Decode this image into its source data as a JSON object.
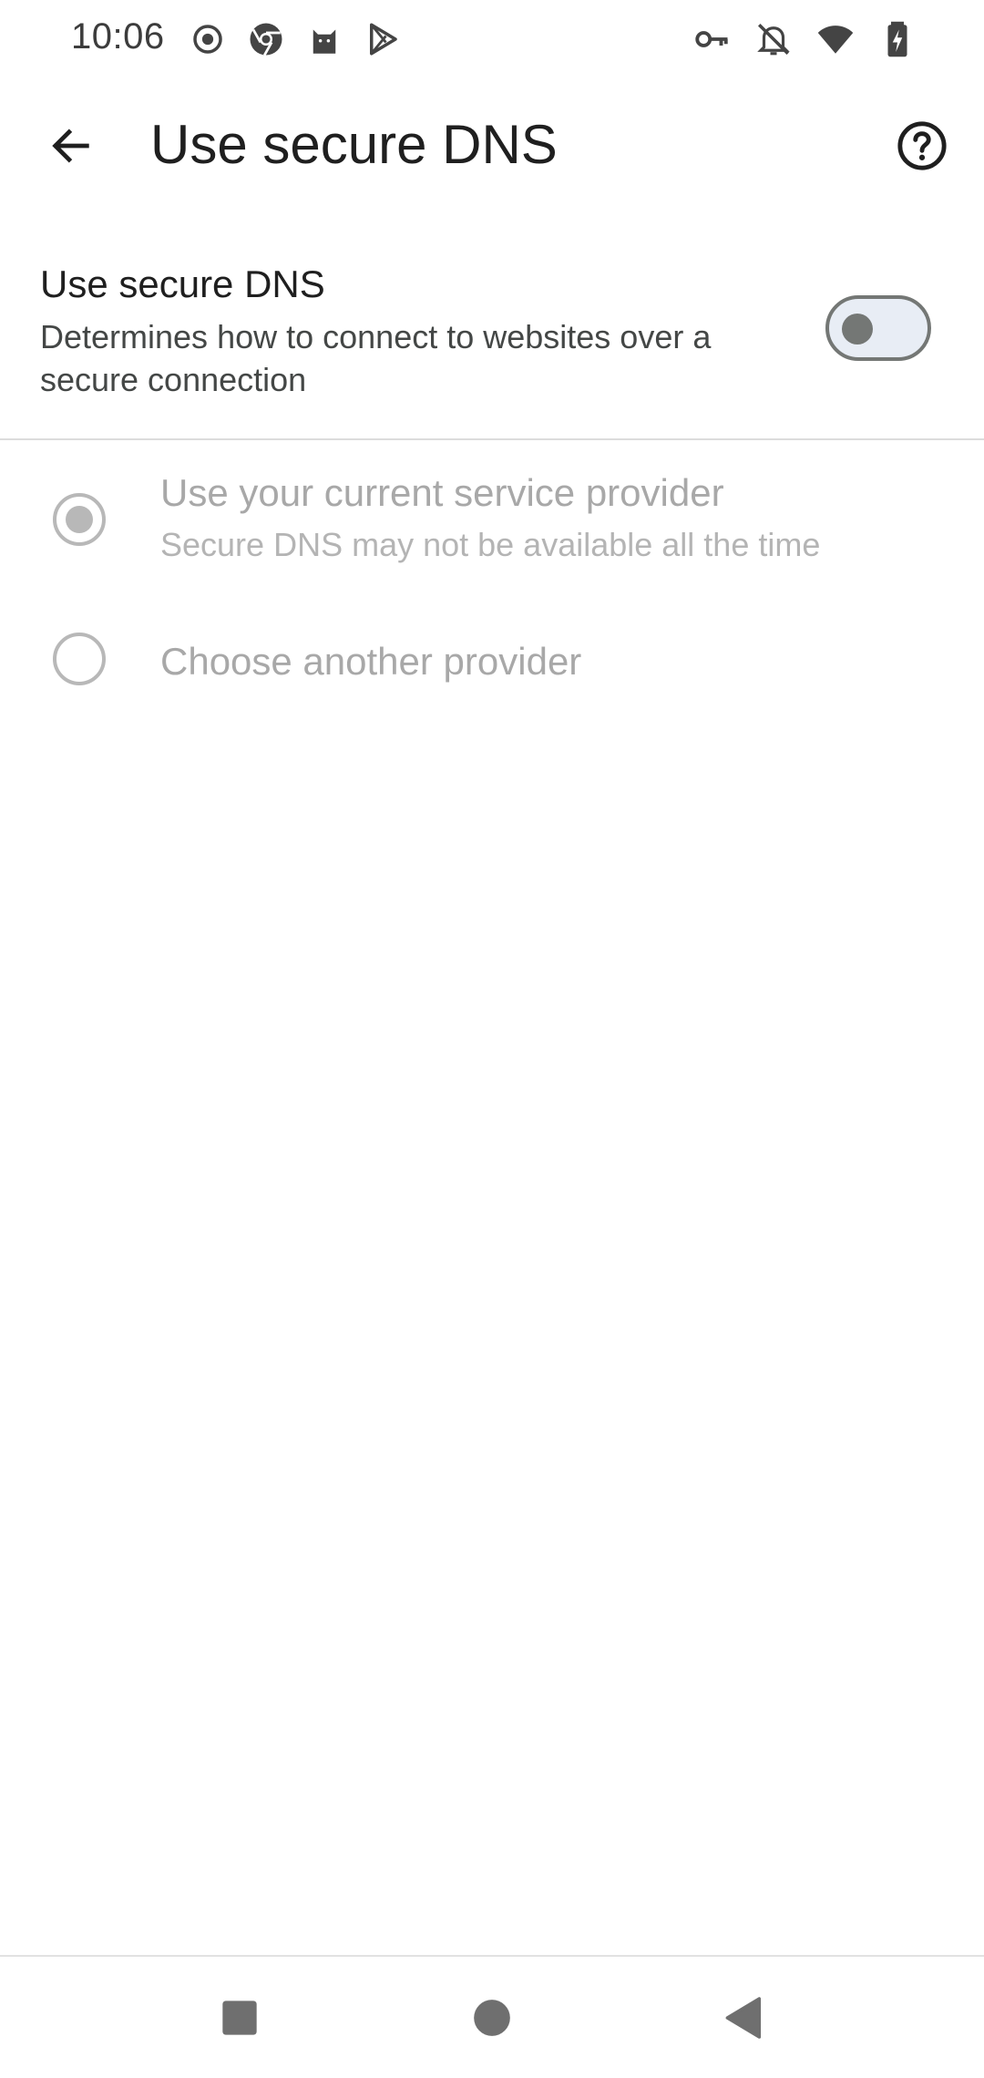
{
  "status_bar": {
    "time": "10:06",
    "left_icons": [
      "record-icon",
      "chromium-icon",
      "cat-icon",
      "play-store-icon"
    ],
    "right_icons": [
      "vpn-key-icon",
      "notifications-off-icon",
      "wifi-icon",
      "battery-charging-icon"
    ]
  },
  "app_bar": {
    "title": "Use secure DNS",
    "back_icon": "arrow-back-icon",
    "help_icon": "help-circle-icon"
  },
  "secure_dns": {
    "title": "Use secure DNS",
    "summary": "Determines how to connect to websites over a secure connection",
    "toggle_on": false
  },
  "options": [
    {
      "title": "Use your current service provider",
      "summary": "Secure DNS may not be available all the time",
      "selected": true,
      "enabled": false
    },
    {
      "title": "Choose another provider",
      "selected": false,
      "enabled": false
    }
  ],
  "colors": {
    "text_primary": "#1f1f1f",
    "text_secondary": "#444746",
    "disabled": "#a8a8a8",
    "switch_outline": "#747775",
    "switch_track": "#e8edf5"
  },
  "nav_bar": {
    "buttons": [
      "recent-apps-icon",
      "home-icon",
      "back-triangle-icon"
    ]
  }
}
